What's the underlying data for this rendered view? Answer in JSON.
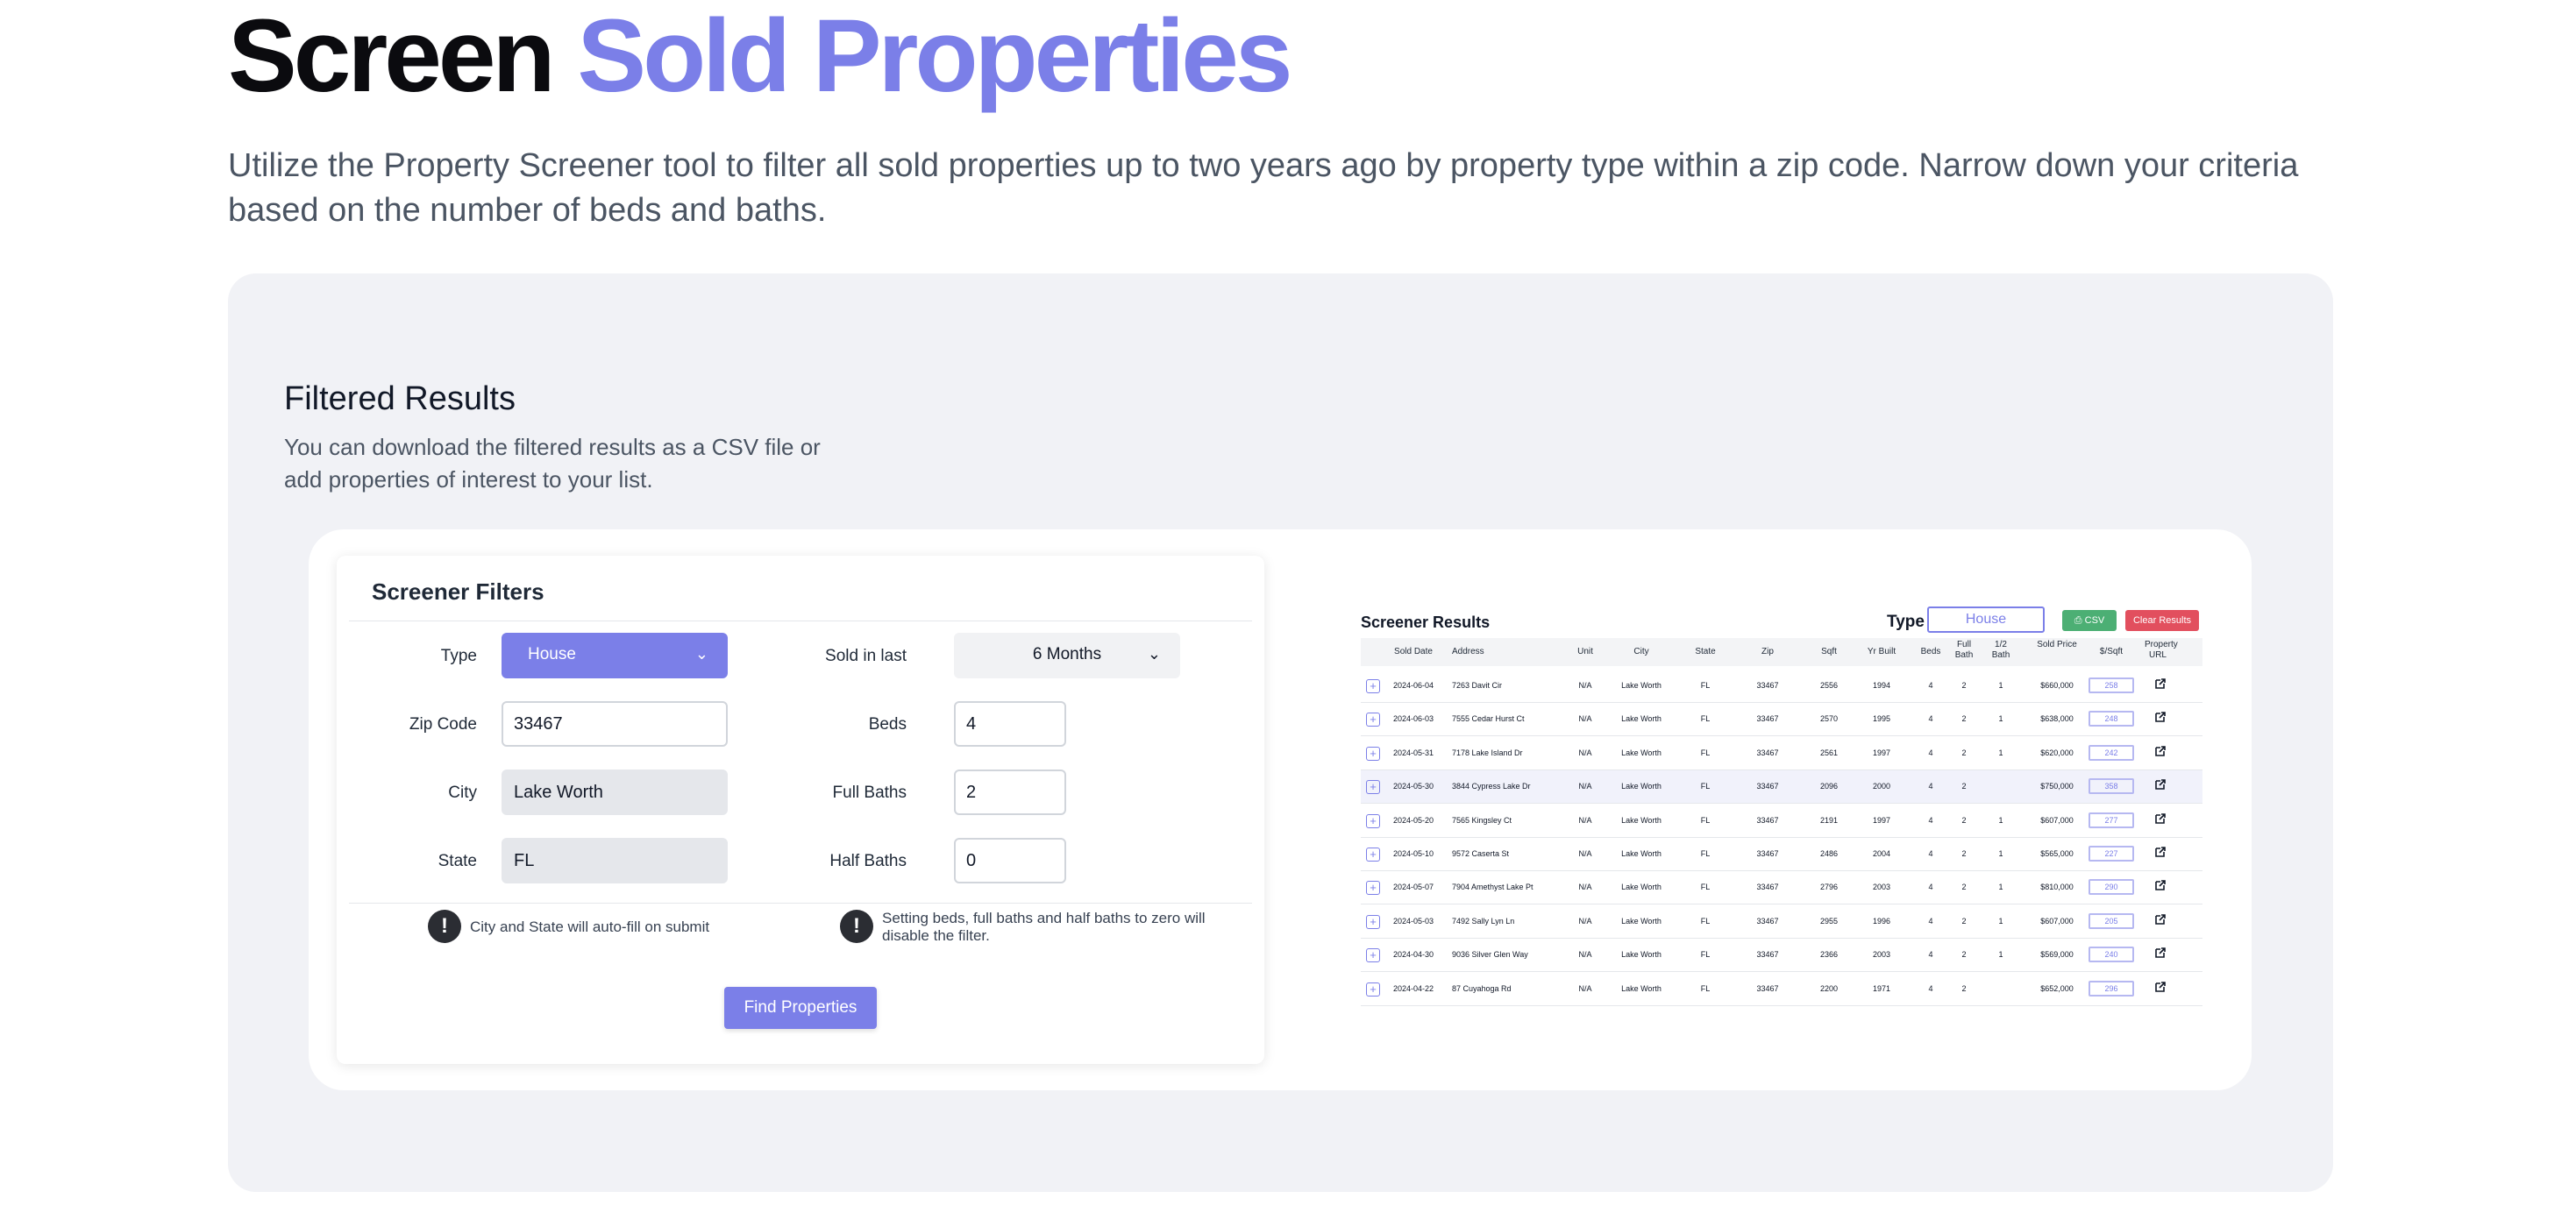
{
  "hero": {
    "title_plain": "Screen",
    "title_accent": "Sold Properties",
    "accent_color": "#7b7fe8",
    "description": "Utilize the Property Screener tool to filter all sold properties up to two years ago by property type within a zip code. Narrow down your criteria based on the number of beds and baths."
  },
  "panel": {
    "title": "Filtered Results",
    "description": "You can download the filtered results as a CSV file or add properties of interest to your list."
  },
  "filters": {
    "title": "Screener Filters",
    "type_label": "Type",
    "type_value": "House",
    "zip_label": "Zip Code",
    "zip_value": "33467",
    "city_label": "City",
    "city_value": "Lake Worth",
    "state_label": "State",
    "state_value": "FL",
    "sold_label": "Sold in last",
    "sold_value": "6 Months",
    "beds_label": "Beds",
    "beds_value": "4",
    "full_baths_label": "Full Baths",
    "full_baths_value": "2",
    "half_baths_label": "Half Baths",
    "half_baths_value": "0",
    "note_autofill": "City and State will auto-fill on submit",
    "note_zero": "Setting beds, full baths and half baths to zero will disable the filter.",
    "find_button": "Find Properties"
  },
  "results": {
    "title": "Screener Results",
    "type_label": "Type",
    "type_value": "House",
    "csv_button": "CSV",
    "clear_button": "Clear Results",
    "csv_color": "#4caf74",
    "clear_color": "#e24f5e",
    "columns": [
      "Sold Date",
      "Address",
      "Unit",
      "City",
      "State",
      "Zip",
      "Sqft",
      "Yr Built",
      "Beds",
      "Full Bath",
      "1/2 Bath",
      "Sold Price",
      "$/Sqft",
      "Property URL"
    ],
    "rows": [
      {
        "date": "2024-06-04",
        "address": "7263 Davit Cir",
        "unit": "N/A",
        "city": "Lake Worth",
        "state": "FL",
        "zip": "33467",
        "sqft": "2556",
        "yr": "1994",
        "beds": "4",
        "full": "2",
        "half": "1",
        "price": "$660,000",
        "ppsf": "258"
      },
      {
        "date": "2024-06-03",
        "address": "7555 Cedar Hurst Ct",
        "unit": "N/A",
        "city": "Lake Worth",
        "state": "FL",
        "zip": "33467",
        "sqft": "2570",
        "yr": "1995",
        "beds": "4",
        "full": "2",
        "half": "1",
        "price": "$638,000",
        "ppsf": "248"
      },
      {
        "date": "2024-05-31",
        "address": "7178 Lake Island Dr",
        "unit": "N/A",
        "city": "Lake Worth",
        "state": "FL",
        "zip": "33467",
        "sqft": "2561",
        "yr": "1997",
        "beds": "4",
        "full": "2",
        "half": "1",
        "price": "$620,000",
        "ppsf": "242"
      },
      {
        "date": "2024-05-30",
        "address": "3844 Cypress Lake Dr",
        "unit": "N/A",
        "city": "Lake Worth",
        "state": "FL",
        "zip": "33467",
        "sqft": "2096",
        "yr": "2000",
        "beds": "4",
        "full": "2",
        "half": "",
        "price": "$750,000",
        "ppsf": "358"
      },
      {
        "date": "2024-05-20",
        "address": "7565 Kingsley Ct",
        "unit": "N/A",
        "city": "Lake Worth",
        "state": "FL",
        "zip": "33467",
        "sqft": "2191",
        "yr": "1997",
        "beds": "4",
        "full": "2",
        "half": "1",
        "price": "$607,000",
        "ppsf": "277"
      },
      {
        "date": "2024-05-10",
        "address": "9572 Caserta St",
        "unit": "N/A",
        "city": "Lake Worth",
        "state": "FL",
        "zip": "33467",
        "sqft": "2486",
        "yr": "2004",
        "beds": "4",
        "full": "2",
        "half": "1",
        "price": "$565,000",
        "ppsf": "227"
      },
      {
        "date": "2024-05-07",
        "address": "7904 Amethyst Lake Pt",
        "unit": "N/A",
        "city": "Lake Worth",
        "state": "FL",
        "zip": "33467",
        "sqft": "2796",
        "yr": "2003",
        "beds": "4",
        "full": "2",
        "half": "1",
        "price": "$810,000",
        "ppsf": "290"
      },
      {
        "date": "2024-05-03",
        "address": "7492 Sally Lyn Ln",
        "unit": "N/A",
        "city": "Lake Worth",
        "state": "FL",
        "zip": "33467",
        "sqft": "2955",
        "yr": "1996",
        "beds": "4",
        "full": "2",
        "half": "1",
        "price": "$607,000",
        "ppsf": "205"
      },
      {
        "date": "2024-04-30",
        "address": "9036 Silver Glen Way",
        "unit": "N/A",
        "city": "Lake Worth",
        "state": "FL",
        "zip": "33467",
        "sqft": "2366",
        "yr": "2003",
        "beds": "4",
        "full": "2",
        "half": "1",
        "price": "$569,000",
        "ppsf": "240"
      },
      {
        "date": "2024-04-22",
        "address": "87 Cuyahoga Rd",
        "unit": "N/A",
        "city": "Lake Worth",
        "state": "FL",
        "zip": "33467",
        "sqft": "2200",
        "yr": "1971",
        "beds": "4",
        "full": "2",
        "half": "",
        "price": "$652,000",
        "ppsf": "296"
      }
    ],
    "highlighted_row_index": 3
  }
}
